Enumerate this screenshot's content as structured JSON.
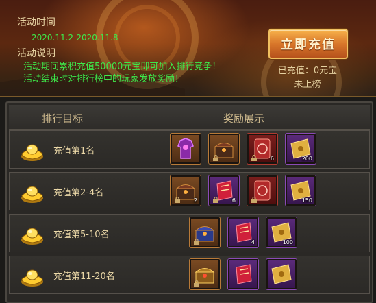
{
  "event": {
    "time_label": "活动时间",
    "date_range": "2020.11.2-2020.11.8",
    "desc_label": "活动说明",
    "desc_line1": "活动期间累积充值50000元宝即可加入排行竞争！",
    "desc_line2": "活动结束时对排行榜中的玩家发放奖励！",
    "topup_button": "立即充值",
    "recharged": "已充值：0元宝",
    "rank_status": "未上榜"
  },
  "table": {
    "col_target": "排行目标",
    "col_rewards": "奖励展示",
    "rows": [
      {
        "label": "充值第1名",
        "items": [
          {
            "icon": "purple-armor-icon",
            "frame": "orange",
            "count": "",
            "locked": false
          },
          {
            "icon": "treasure-chest-icon",
            "frame": "orange",
            "count": "",
            "locked": true
          },
          {
            "icon": "red-seal-scroll-icon",
            "frame": "red",
            "count": "6",
            "locked": true
          },
          {
            "icon": "gold-scroll-icon",
            "frame": "purple",
            "count": "200",
            "locked": false
          }
        ]
      },
      {
        "label": "充值第2-4名",
        "items": [
          {
            "icon": "treasure-chest-icon",
            "frame": "orange",
            "count": "2",
            "locked": true
          },
          {
            "icon": "red-talisman-icon",
            "frame": "purple",
            "count": "6",
            "locked": true
          },
          {
            "icon": "red-seal-scroll-icon",
            "frame": "red",
            "count": "",
            "locked": true
          },
          {
            "icon": "gold-scroll-icon",
            "frame": "purple",
            "count": "150",
            "locked": false
          }
        ]
      },
      {
        "label": "充值第5-10名",
        "items": [
          {
            "icon": "blue-chest-icon",
            "frame": "orange",
            "count": "",
            "locked": true
          },
          {
            "icon": "red-talisman-icon",
            "frame": "purple",
            "count": "4",
            "locked": false
          },
          {
            "icon": "gold-scroll-icon",
            "frame": "purple",
            "count": "100",
            "locked": false
          }
        ]
      },
      {
        "label": "充值第11-20名",
        "items": [
          {
            "icon": "gold-chest-icon",
            "frame": "orange",
            "count": "",
            "locked": true
          },
          {
            "icon": "red-talisman-icon",
            "frame": "purple",
            "count": "",
            "locked": false
          },
          {
            "icon": "gold-scroll-icon",
            "frame": "purple",
            "count": "",
            "locked": false
          }
        ]
      }
    ]
  },
  "colors": {
    "green_text": "#3ee84a",
    "label_text": "#e6d2a2",
    "button_orange": "#d8762a"
  }
}
